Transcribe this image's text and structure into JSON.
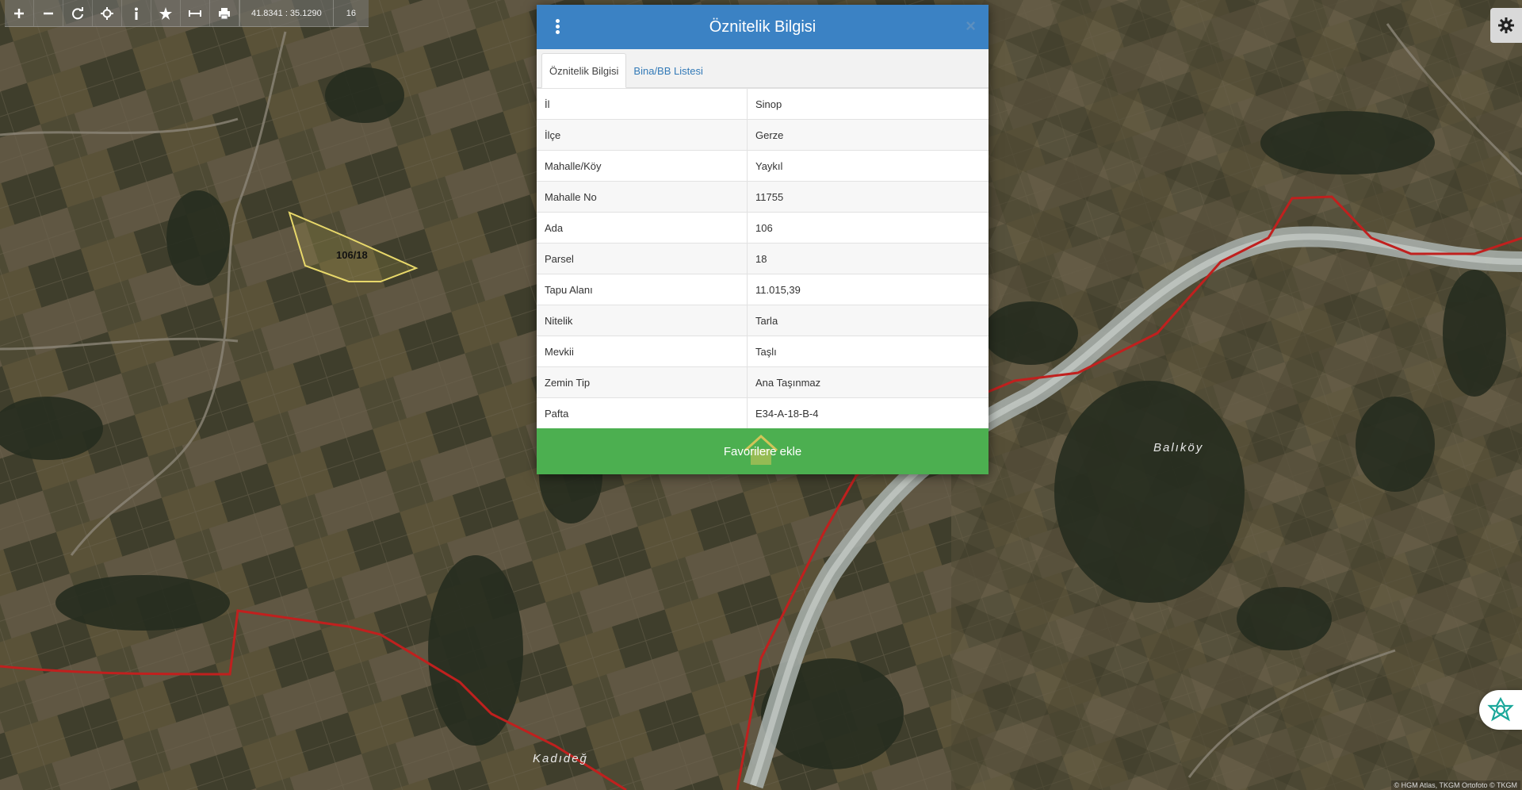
{
  "toolbar": {
    "coordinates": "41.8341 : 35.1290",
    "zoom": "16",
    "icons": [
      "plus-icon",
      "minus-icon",
      "refresh-icon",
      "locate-icon",
      "info-icon",
      "star-icon",
      "measure-icon",
      "print-icon"
    ]
  },
  "map": {
    "place_labels": [
      "Balıköy",
      "Kadıdeğ"
    ],
    "parcel_label": "106/18",
    "attribution": "© HGM Atlas, TKGM Ortofoto © TKGM",
    "colors": {
      "parcel_outline": "#e8d86a",
      "boundary": "#c0201e",
      "river": "#a9b2ae"
    }
  },
  "modal": {
    "title": "Öznitelik Bilgisi",
    "tabs": [
      {
        "label": "Öznitelik Bilgisi",
        "active": true
      },
      {
        "label": "Bina/BB Listesi",
        "active": false
      }
    ],
    "rows": [
      {
        "key": "İl",
        "value": "Sinop"
      },
      {
        "key": "İlçe",
        "value": "Gerze"
      },
      {
        "key": "Mahalle/Köy",
        "value": "Yaykıl"
      },
      {
        "key": "Mahalle No",
        "value": "11755"
      },
      {
        "key": "Ada",
        "value": "106"
      },
      {
        "key": "Parsel",
        "value": "18"
      },
      {
        "key": "Tapu Alanı",
        "value": "11.015,39"
      },
      {
        "key": "Nitelik",
        "value": "Tarla"
      },
      {
        "key": "Mevkii",
        "value": "Taşlı"
      },
      {
        "key": "Zemin Tip",
        "value": "Ana Taşınmaz"
      },
      {
        "key": "Pafta",
        "value": "E34-A-18-B-4"
      }
    ],
    "favorite_button": "Favorilere ekle",
    "colors": {
      "header": "#3b82c4",
      "button": "#4caf50"
    }
  }
}
